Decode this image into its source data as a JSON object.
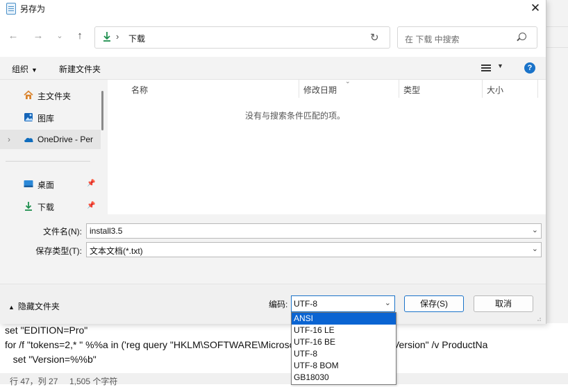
{
  "background": {
    "code_lines": [
      "set \"EDITION=Pro\"",
      "for /f \"tokens=2,* \" %%a in ('reg query \"HKLM\\SOFTWARE\\Microsoft\\Windows NT\\CurrentVersion\" /v ProductNa",
      "   set \"Version=%%b\""
    ],
    "status_position": "行 47，列 27",
    "status_count": "1,505 个字符"
  },
  "dialog": {
    "title": "另存为",
    "address_crumb": "下载",
    "search_placeholder": "在 下载 中搜索",
    "toolbar": {
      "organize": "组织",
      "new_folder": "新建文件夹"
    },
    "sidebar": [
      {
        "label": "主文件夹",
        "icon": "home-icon"
      },
      {
        "label": "图库",
        "icon": "gallery-icon"
      },
      {
        "label": "OneDrive - Per",
        "icon": "onedrive-icon",
        "selected": true
      },
      {
        "label": "桌面",
        "icon": "desktop-icon",
        "pinned": true
      },
      {
        "label": "下载",
        "icon": "download-icon",
        "pinned": true
      }
    ],
    "columns": [
      "名称",
      "修改日期",
      "类型",
      "大小"
    ],
    "empty_message": "没有与搜索条件匹配的项。",
    "filename_label": "文件名(N):",
    "filename_value": "install3.5",
    "filetype_label": "保存类型(T):",
    "filetype_value": "文本文档(*.txt)",
    "hide_folders": "隐藏文件夹",
    "encoding_label": "编码:",
    "encoding_value": "UTF-8",
    "save_button": "保存(S)",
    "cancel_button": "取消",
    "encoding_options": [
      "ANSI",
      "UTF-16 LE",
      "UTF-16 BE",
      "UTF-8",
      "UTF-8 BOM",
      "GB18030"
    ],
    "encoding_highlighted": "ANSI"
  },
  "colors": {
    "accent": "#1a73c9",
    "highlight": "#0a64d2"
  }
}
